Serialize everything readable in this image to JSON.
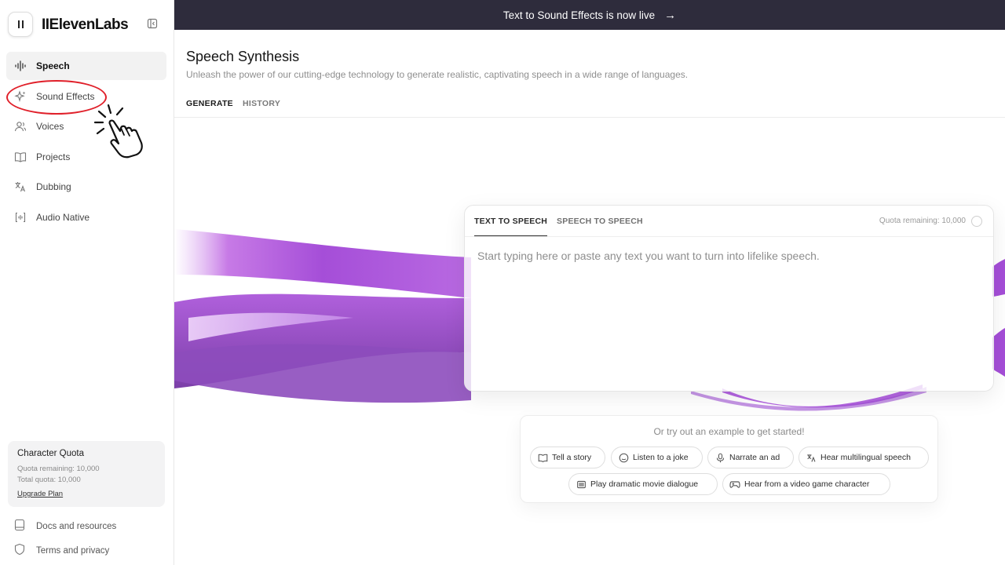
{
  "banner": {
    "text": "Text to Sound Effects is now live",
    "arrow": "→"
  },
  "sidebar": {
    "brand": "IIElevenLabs",
    "items": [
      {
        "label": "Speech",
        "icon": "waveform-icon",
        "active": true
      },
      {
        "label": "Sound Effects",
        "icon": "sparkles-icon",
        "active": false
      },
      {
        "label": "Voices",
        "icon": "users-icon",
        "active": false
      },
      {
        "label": "Projects",
        "icon": "book-icon",
        "active": false
      },
      {
        "label": "Dubbing",
        "icon": "translate-icon",
        "active": false
      },
      {
        "label": "Audio Native",
        "icon": "audio-embed-icon",
        "active": false
      }
    ],
    "quota": {
      "title": "Character Quota",
      "remaining": "Quota remaining: 10,000",
      "total": "Total quota: 10,000",
      "upgrade": "Upgrade Plan"
    },
    "bottom": [
      {
        "label": "Docs and resources",
        "icon": "docs-icon"
      },
      {
        "label": "Terms and privacy",
        "icon": "shield-icon"
      }
    ]
  },
  "main": {
    "title": "Speech Synthesis",
    "subtitle": "Unleash the power of our cutting-edge technology to generate realistic, captivating speech in a wide range of languages.",
    "tabs": [
      "GENERATE",
      "HISTORY"
    ]
  },
  "editor": {
    "tabs": [
      "TEXT TO SPEECH",
      "SPEECH TO SPEECH"
    ],
    "quota": "Quota remaining: 10,000",
    "placeholder": "Start typing here or paste any text you want to turn into lifelike speech."
  },
  "examples": {
    "title": "Or try out an example to get started!",
    "chips": [
      {
        "label": "Tell a story",
        "icon": "book-icon"
      },
      {
        "label": "Listen to a joke",
        "icon": "smile-icon"
      },
      {
        "label": "Narrate an ad",
        "icon": "microphone-icon"
      },
      {
        "label": "Hear multilingual speech",
        "icon": "translate-icon"
      },
      {
        "label": "Play dramatic movie dialogue",
        "icon": "film-icon"
      },
      {
        "label": "Hear from a video game character",
        "icon": "gamepad-icon"
      }
    ]
  },
  "colors": {
    "banner": "#2e2c3c",
    "accent_purple": "#a24fd6",
    "annotation_red": "#e0202a"
  }
}
